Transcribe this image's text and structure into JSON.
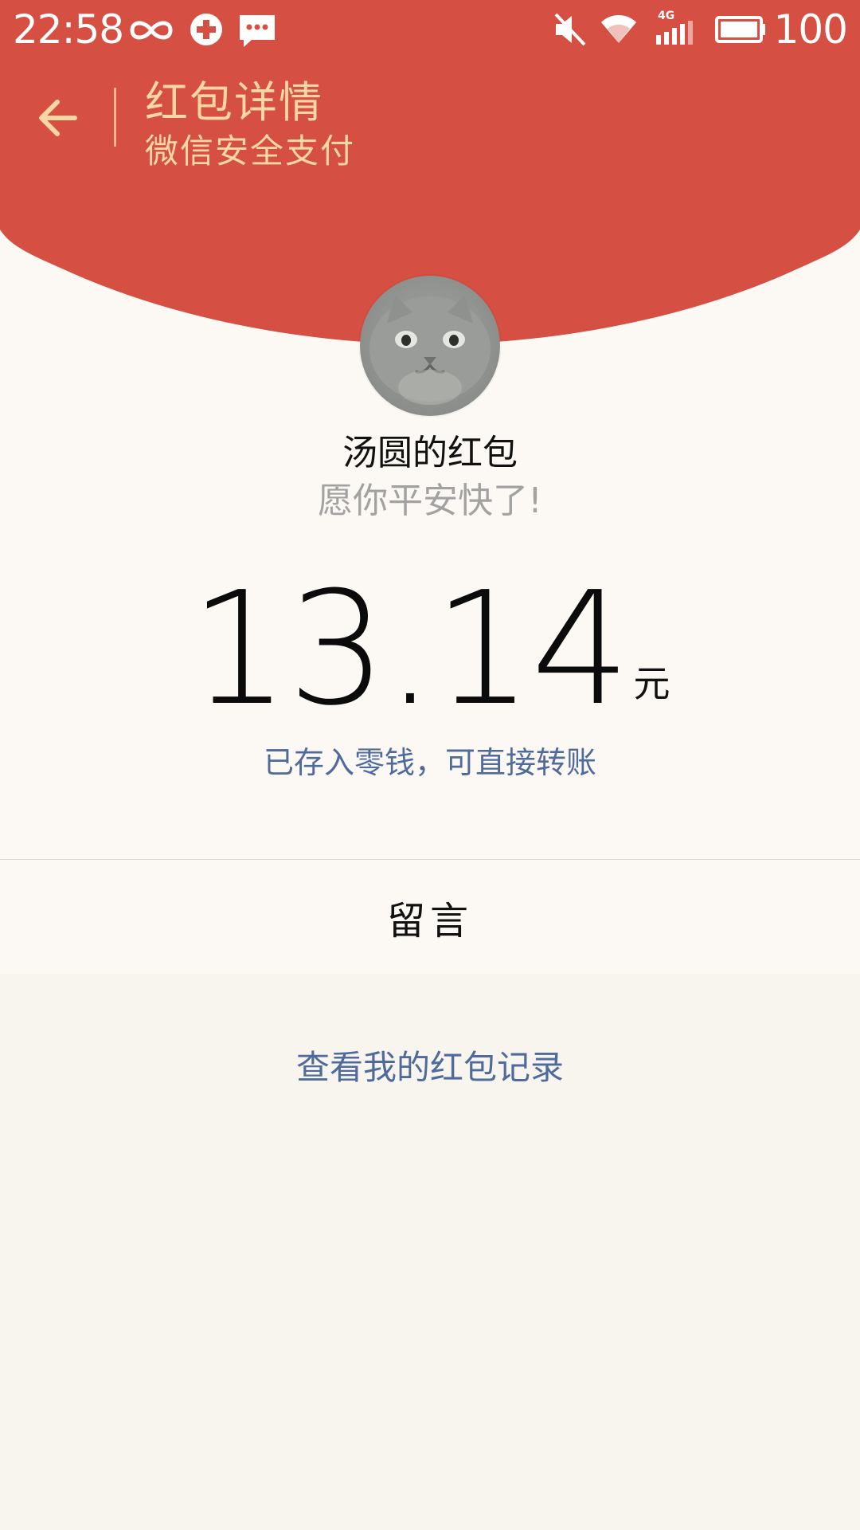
{
  "status_bar": {
    "time": "22:58",
    "battery_level": "100",
    "network_label": "4G",
    "icons": [
      "infinity-icon",
      "sync-plus-icon",
      "message-icon",
      "mute-icon",
      "wifi-icon",
      "signal-icon",
      "battery-icon"
    ]
  },
  "header": {
    "title": "红包详情",
    "subtitle": "微信安全支付",
    "back_icon": "arrow-left-icon"
  },
  "red_packet": {
    "sender": "汤圆的红包",
    "greeting": "愿你平安快了!",
    "amount": "13.14",
    "currency": "元",
    "note": "已存入零钱，可直接转账"
  },
  "actions": {
    "message_label": "留言",
    "records_link": "查看我的红包记录"
  },
  "colors": {
    "header_red": "#d64f43",
    "title_gold": "#f8d7a4",
    "link_blue": "#4f6a9c",
    "page_bg": "#f8f5ef"
  }
}
